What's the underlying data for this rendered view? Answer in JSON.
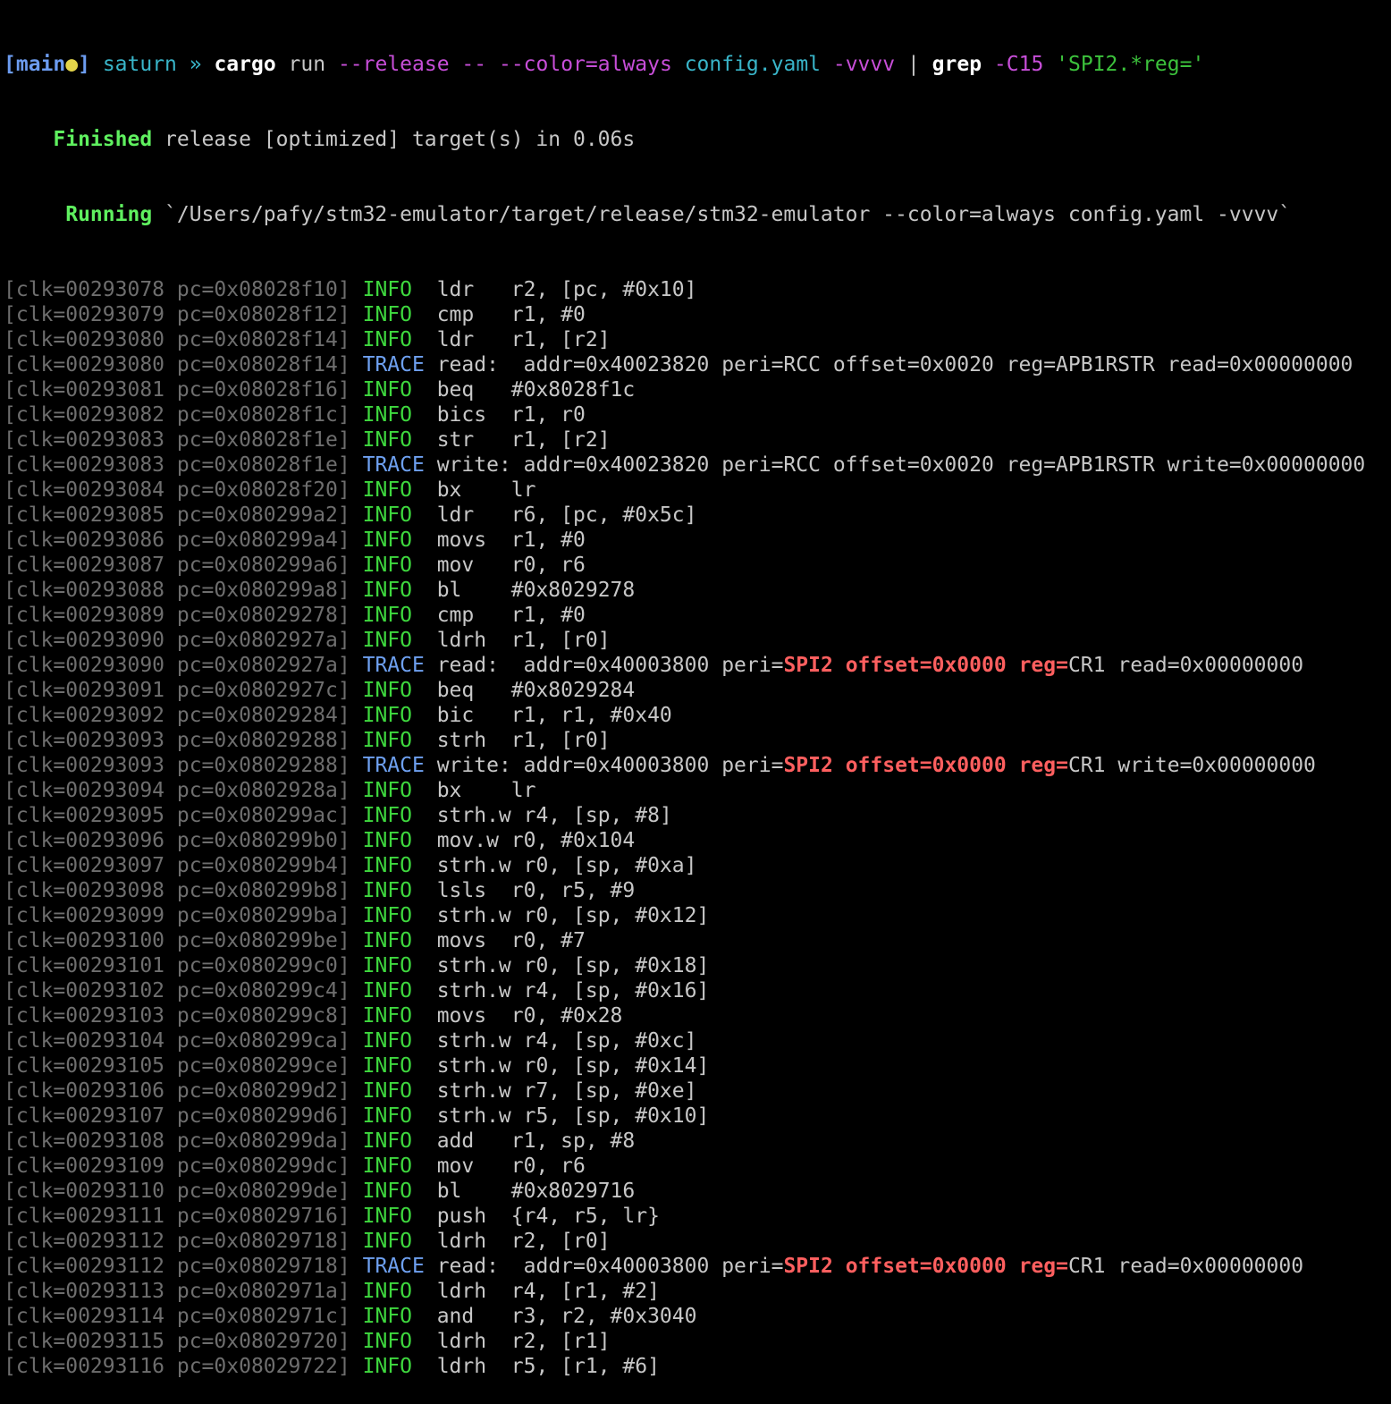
{
  "prompt": {
    "open_bracket": "[",
    "branch": "main",
    "dirty_dot": "●",
    "close_bracket": "]",
    "host": " saturn",
    "arrow": " »",
    "cmd": " cargo",
    "arg_run": " run",
    "flag1": " --release",
    "flag2": " --",
    "flag3": " --color=always",
    "file": " config.yaml",
    "flag4": " -vvvv",
    "pipe": " |",
    "grep": " grep",
    "flag5": " -C15",
    "pattern": " 'SPI2.*reg='"
  },
  "cargo_finished": {
    "label": "    Finished",
    "text": " release [optimized] target(s) in 0.06s"
  },
  "cargo_running": {
    "label": "     Running",
    "text": " `/Users/pafy/stm32-emulator/target/release/stm32-emulator --color=always config.yaml -vvvv`"
  },
  "highlight": {
    "peri": "SPI2",
    "offset": "offset=0x0000",
    "reg": "reg="
  },
  "log": [
    {
      "prefix": "[clk=00293078 pc=0x08028f10]",
      "level": "INFO",
      "msg": "ldr   r2, [pc, #0x10]"
    },
    {
      "prefix": "[clk=00293079 pc=0x08028f12]",
      "level": "INFO",
      "msg": "cmp   r1, #0"
    },
    {
      "prefix": "[clk=00293080 pc=0x08028f14]",
      "level": "INFO",
      "msg": "ldr   r1, [r2]"
    },
    {
      "prefix": "[clk=00293080 pc=0x08028f14]",
      "level": "TRACE",
      "msg": "read:  addr=0x40023820 peri=RCC offset=0x0020 reg=APB1RSTR read=0x00000000"
    },
    {
      "prefix": "[clk=00293081 pc=0x08028f16]",
      "level": "INFO",
      "msg": "beq   #0x8028f1c"
    },
    {
      "prefix": "[clk=00293082 pc=0x08028f1c]",
      "level": "INFO",
      "msg": "bics  r1, r0"
    },
    {
      "prefix": "[clk=00293083 pc=0x08028f1e]",
      "level": "INFO",
      "msg": "str   r1, [r2]"
    },
    {
      "prefix": "[clk=00293083 pc=0x08028f1e]",
      "level": "TRACE",
      "msg": "write: addr=0x40023820 peri=RCC offset=0x0020 reg=APB1RSTR write=0x00000000"
    },
    {
      "prefix": "[clk=00293084 pc=0x08028f20]",
      "level": "INFO",
      "msg": "bx    lr"
    },
    {
      "prefix": "[clk=00293085 pc=0x080299a2]",
      "level": "INFO",
      "msg": "ldr   r6, [pc, #0x5c]"
    },
    {
      "prefix": "[clk=00293086 pc=0x080299a4]",
      "level": "INFO",
      "msg": "movs  r1, #0"
    },
    {
      "prefix": "[clk=00293087 pc=0x080299a6]",
      "level": "INFO",
      "msg": "mov   r0, r6"
    },
    {
      "prefix": "[clk=00293088 pc=0x080299a8]",
      "level": "INFO",
      "msg": "bl    #0x8029278"
    },
    {
      "prefix": "[clk=00293089 pc=0x08029278]",
      "level": "INFO",
      "msg": "cmp   r1, #0"
    },
    {
      "prefix": "[clk=00293090 pc=0x0802927a]",
      "level": "INFO",
      "msg": "ldrh  r1, [r0]"
    },
    {
      "prefix": "[clk=00293090 pc=0x0802927a]",
      "level": "TRACE",
      "msg_a": "read:  addr=0x40003800 peri=",
      "msg_b": "CR1 read=0x00000000"
    },
    {
      "prefix": "[clk=00293091 pc=0x0802927c]",
      "level": "INFO",
      "msg": "beq   #0x8029284"
    },
    {
      "prefix": "[clk=00293092 pc=0x08029284]",
      "level": "INFO",
      "msg": "bic   r1, r1, #0x40"
    },
    {
      "prefix": "[clk=00293093 pc=0x08029288]",
      "level": "INFO",
      "msg": "strh  r1, [r0]"
    },
    {
      "prefix": "[clk=00293093 pc=0x08029288]",
      "level": "TRACE",
      "msg_a": "write: addr=0x40003800 peri=",
      "msg_b": "CR1 write=0x00000000"
    },
    {
      "prefix": "[clk=00293094 pc=0x0802928a]",
      "level": "INFO",
      "msg": "bx    lr"
    },
    {
      "prefix": "[clk=00293095 pc=0x080299ac]",
      "level": "INFO",
      "msg": "strh.w r4, [sp, #8]"
    },
    {
      "prefix": "[clk=00293096 pc=0x080299b0]",
      "level": "INFO",
      "msg": "mov.w r0, #0x104"
    },
    {
      "prefix": "[clk=00293097 pc=0x080299b4]",
      "level": "INFO",
      "msg": "strh.w r0, [sp, #0xa]"
    },
    {
      "prefix": "[clk=00293098 pc=0x080299b8]",
      "level": "INFO",
      "msg": "lsls  r0, r5, #9"
    },
    {
      "prefix": "[clk=00293099 pc=0x080299ba]",
      "level": "INFO",
      "msg": "strh.w r0, [sp, #0x12]"
    },
    {
      "prefix": "[clk=00293100 pc=0x080299be]",
      "level": "INFO",
      "msg": "movs  r0, #7"
    },
    {
      "prefix": "[clk=00293101 pc=0x080299c0]",
      "level": "INFO",
      "msg": "strh.w r0, [sp, #0x18]"
    },
    {
      "prefix": "[clk=00293102 pc=0x080299c4]",
      "level": "INFO",
      "msg": "strh.w r4, [sp, #0x16]"
    },
    {
      "prefix": "[clk=00293103 pc=0x080299c8]",
      "level": "INFO",
      "msg": "movs  r0, #0x28"
    },
    {
      "prefix": "[clk=00293104 pc=0x080299ca]",
      "level": "INFO",
      "msg": "strh.w r4, [sp, #0xc]"
    },
    {
      "prefix": "[clk=00293105 pc=0x080299ce]",
      "level": "INFO",
      "msg": "strh.w r0, [sp, #0x14]"
    },
    {
      "prefix": "[clk=00293106 pc=0x080299d2]",
      "level": "INFO",
      "msg": "strh.w r7, [sp, #0xe]"
    },
    {
      "prefix": "[clk=00293107 pc=0x080299d6]",
      "level": "INFO",
      "msg": "strh.w r5, [sp, #0x10]"
    },
    {
      "prefix": "[clk=00293108 pc=0x080299da]",
      "level": "INFO",
      "msg": "add   r1, sp, #8"
    },
    {
      "prefix": "[clk=00293109 pc=0x080299dc]",
      "level": "INFO",
      "msg": "mov   r0, r6"
    },
    {
      "prefix": "[clk=00293110 pc=0x080299de]",
      "level": "INFO",
      "msg": "bl    #0x8029716"
    },
    {
      "prefix": "[clk=00293111 pc=0x08029716]",
      "level": "INFO",
      "msg": "push  {r4, r5, lr}"
    },
    {
      "prefix": "[clk=00293112 pc=0x08029718]",
      "level": "INFO",
      "msg": "ldrh  r2, [r0]"
    },
    {
      "prefix": "[clk=00293112 pc=0x08029718]",
      "level": "TRACE",
      "msg_a": "read:  addr=0x40003800 peri=",
      "msg_b": "CR1 read=0x00000000"
    },
    {
      "prefix": "[clk=00293113 pc=0x0802971a]",
      "level": "INFO",
      "msg": "ldrh  r4, [r1, #2]"
    },
    {
      "prefix": "[clk=00293114 pc=0x0802971c]",
      "level": "INFO",
      "msg": "and   r3, r2, #0x3040"
    },
    {
      "prefix": "[clk=00293115 pc=0x08029720]",
      "level": "INFO",
      "msg": "ldrh  r2, [r1]"
    },
    {
      "prefix": "[clk=00293116 pc=0x08029722]",
      "level": "INFO",
      "msg": "ldrh  r5, [r1, #6]"
    }
  ]
}
